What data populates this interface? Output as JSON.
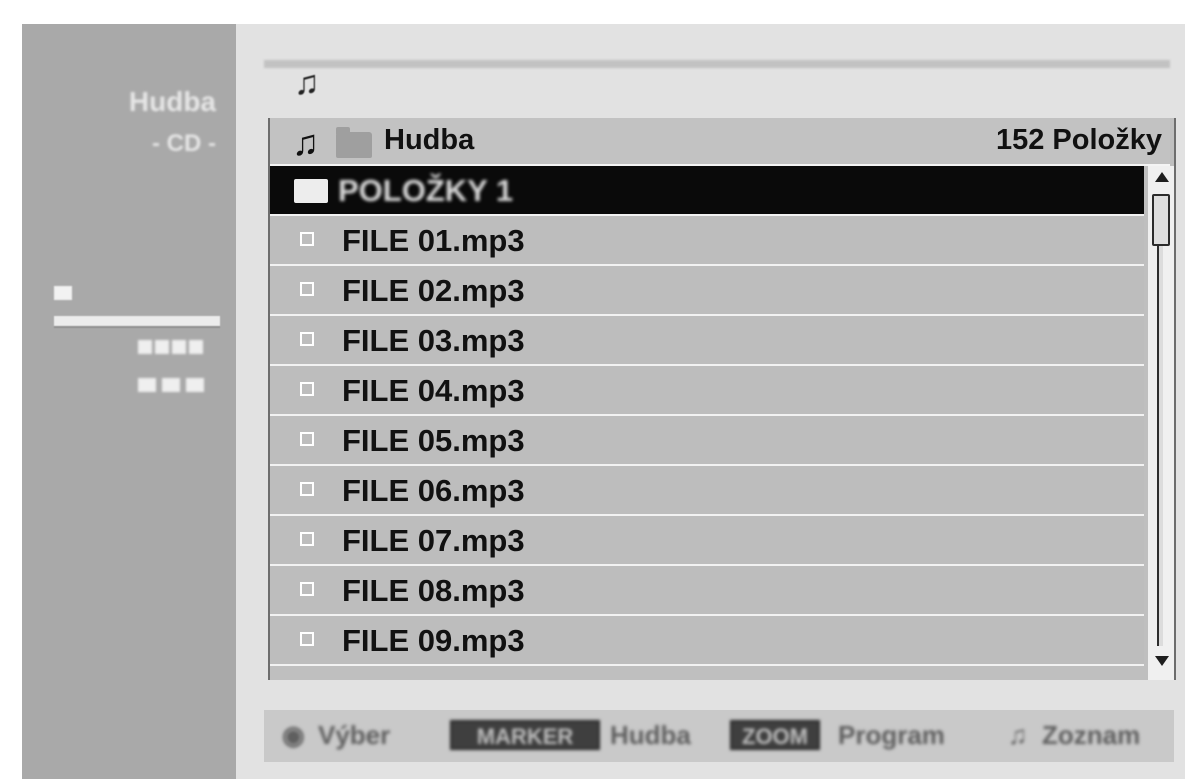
{
  "sidebar": {
    "title": "Hudba",
    "subtitle": "- CD -"
  },
  "list": {
    "folder_name": "Hudba",
    "item_count": "152 Položky",
    "selected_item": "POLOŽKY 1",
    "files": [
      "FILE 01.mp3",
      "FILE 02.mp3",
      "FILE 03.mp3",
      "FILE 04.mp3",
      "FILE 05.mp3",
      "FILE 06.mp3",
      "FILE 07.mp3",
      "FILE 08.mp3",
      "FILE 09.mp3"
    ]
  },
  "footer": {
    "select_label": "Výber",
    "key1": "MARKER",
    "key1_label": "Hudba",
    "key2": "ZOOM",
    "key2_label": "Program",
    "playlist_label": "Zoznam"
  },
  "icons": {
    "music": "music-note-icon",
    "folder": "folder-icon"
  }
}
